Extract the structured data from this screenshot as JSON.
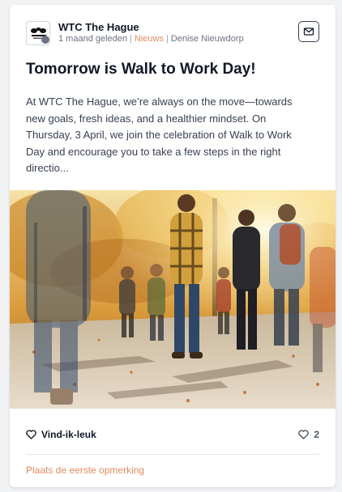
{
  "post": {
    "author": "WTC The Hague",
    "time_ago": "1 maand geleden",
    "category": "Nieuws",
    "posted_by": "Denise Nieuwdorp",
    "title": "Tomorrow is Walk to Work Day!",
    "excerpt": "At WTC The Hague, we’re always on the move—towards new goals, fresh ideas, and a healthier mindset. On Thursday, 3 April, we join the celebration of Walk to Work Day and encourage you to take a few steps in the right directio...",
    "image_alt": "People walking through a sunlit autumn park"
  },
  "actions": {
    "like_label": "Vind-ik-leuk",
    "like_count": "2",
    "comment_prompt": "Plaats de eerste opmerking"
  },
  "icons": {
    "mail": "mail-icon",
    "like": "heart-icon",
    "like_count": "heart-icon"
  },
  "colors": {
    "accent": "#e38a5e",
    "text": "#111827",
    "muted": "#6b7280"
  }
}
